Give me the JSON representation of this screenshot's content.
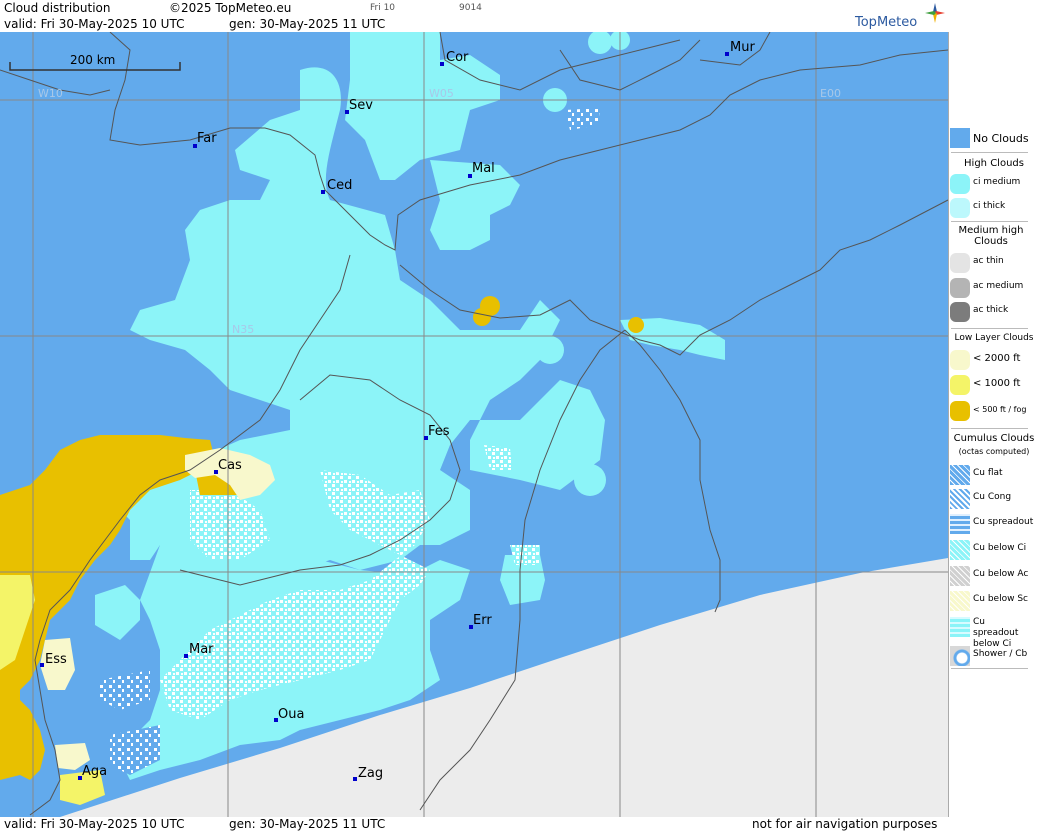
{
  "header": {
    "title": "Cloud distribution",
    "copyright": "©2025 TopMeteo.eu",
    "valid": "valid:  Fri  30-May-2025  10 UTC",
    "gen": "gen: 30-May-2025 11 UTC",
    "tiny1": "Fri 10",
    "tiny2": "9014",
    "logo": "TopMeteo"
  },
  "footer": {
    "valid": "valid:  Fri  30-May-2025  10 UTC",
    "gen": "gen: 30-May-2025 11 UTC",
    "disclaimer": "not for air navigation purposes"
  },
  "map": {
    "scale_label": "200 km",
    "grid_labels": {
      "w10": "W10",
      "w05": "W05",
      "e00": "E00",
      "n35": "N35"
    },
    "cities": [
      {
        "id": "cor",
        "name": "Cor"
      },
      {
        "id": "mur",
        "name": "Mur"
      },
      {
        "id": "sev",
        "name": "Sev"
      },
      {
        "id": "far",
        "name": "Far"
      },
      {
        "id": "mal",
        "name": "Mal"
      },
      {
        "id": "ced",
        "name": "Ced"
      },
      {
        "id": "fes",
        "name": "Fes"
      },
      {
        "id": "cas",
        "name": "Cas"
      },
      {
        "id": "err",
        "name": "Err"
      },
      {
        "id": "mar",
        "name": "Mar"
      },
      {
        "id": "ess",
        "name": "Ess"
      },
      {
        "id": "oua",
        "name": "Oua"
      },
      {
        "id": "aga",
        "name": "Aga"
      },
      {
        "id": "zag",
        "name": "Zag"
      }
    ],
    "colors": {
      "no_clouds": "#62aaec",
      "ci_medium": "#8cf4f8",
      "ci_thick": "#bcf8fc",
      "ac_thin": "#e4e4e4",
      "ac_medium": "#b4b4b4",
      "ac_thick": "#7c7c7c",
      "low_2000": "#f8f8cc",
      "low_1000": "#f4f468",
      "low_500": "#e8c000",
      "outside": "#ececec"
    }
  },
  "legend": {
    "no_clouds": "No Clouds",
    "high_head": "High Clouds",
    "ci_medium": "ci medium",
    "ci_thick": "ci thick",
    "medium_head": "Medium high Clouds",
    "ac_thin": "ac thin",
    "ac_medium": "ac medium",
    "ac_thick": "ac thick",
    "low_head": "Low Layer Clouds",
    "low_2000": "< 2000 ft",
    "low_1000": "< 1000 ft",
    "low_500": "< 500 ft / fog",
    "cu_head": "Cumulus Clouds",
    "cu_sub": "(octas computed)",
    "cu_flat": "Cu flat",
    "cu_cong": "Cu Cong",
    "cu_spread": "Cu spreadout",
    "cu_below_ci": "Cu below Ci",
    "cu_below_ac": "Cu below Ac",
    "cu_below_sc": "Cu below Sc",
    "cu_spread_ci": "Cu spreadout below Ci",
    "shower": "Shower / Cb"
  }
}
